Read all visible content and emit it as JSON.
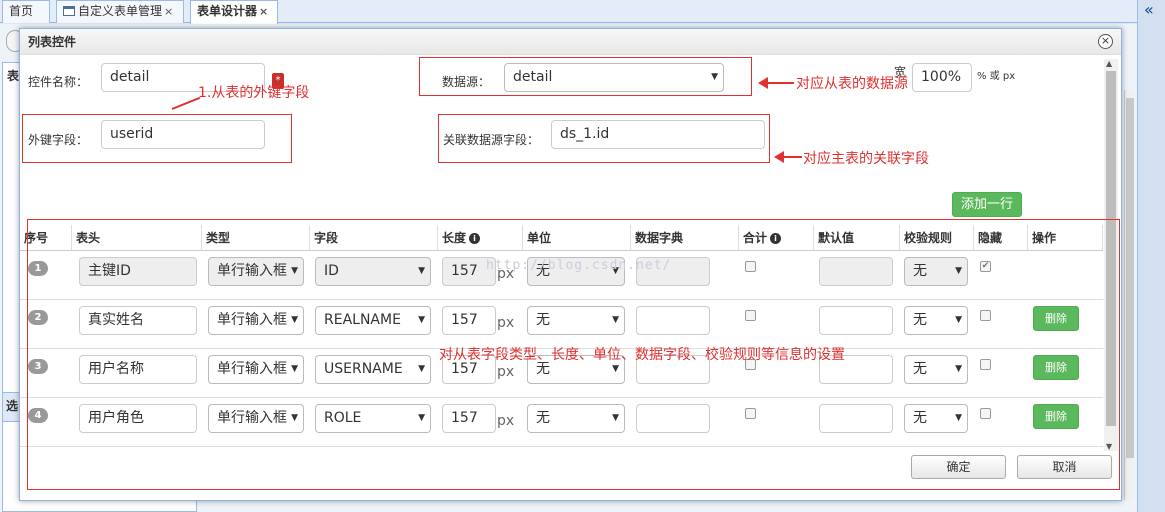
{
  "tabs": [
    {
      "label": "首页"
    },
    {
      "label": "自定义表单管理",
      "close": "×"
    },
    {
      "label": "表单设计器",
      "close": "×"
    }
  ],
  "right_strip": {
    "chevron": "«"
  },
  "left_panel": {
    "title": "表",
    "title2": "选"
  },
  "dialog": {
    "title": "列表控件",
    "close": "×",
    "control_name_label": "控件名称：",
    "control_name_value": "detail",
    "required_mark": "*",
    "datasource_label": "数据源：",
    "datasource_value": "detail",
    "width_label": "宽",
    "width_value": "100%",
    "width_unit": "% 或 px",
    "fk_label": "外键字段：",
    "fk_value": "userid",
    "rel_label": "关联数据源字段：",
    "rel_value": "ds_1.id",
    "add_row": "添加一行",
    "ok": "确定",
    "cancel": "取消"
  },
  "annotations": {
    "fk": "1.从表的外键字段",
    "ds": "对应从表的数据源",
    "rel": "对应主表的关联字段",
    "grid": "对从表字段类型、长度、单位、数据字段、校验规则等信息的设置"
  },
  "watermark": "http://blog.csdn.net/",
  "grid": {
    "headers": [
      "序号",
      "表头",
      "类型",
      "字段",
      "长度",
      "单位",
      "数据字典",
      "合计",
      "默认值",
      "校验规则",
      "隐藏",
      "操作"
    ],
    "rows": [
      {
        "num": "1",
        "header": "主键ID",
        "type": "单行输入框",
        "field": "ID",
        "length": "157",
        "unit_px": "px",
        "unit": "无",
        "rule": "无",
        "hidden": "✔",
        "disabled": true
      },
      {
        "num": "2",
        "header": "真实姓名",
        "type": "单行输入框",
        "field": "REALNAME",
        "length": "157",
        "unit_px": "px",
        "unit": "无",
        "rule": "无",
        "hidden": "",
        "delete": "删除"
      },
      {
        "num": "3",
        "header": "用户名称",
        "type": "单行输入框",
        "field": "USERNAME",
        "length": "157",
        "unit_px": "px",
        "unit": "无",
        "rule": "无",
        "hidden": "",
        "delete": "删除"
      },
      {
        "num": "4",
        "header": "用户角色",
        "type": "单行输入框",
        "field": "ROLE",
        "length": "157",
        "unit_px": "px",
        "unit": "无",
        "rule": "无",
        "hidden": "",
        "delete": "删除"
      }
    ]
  }
}
